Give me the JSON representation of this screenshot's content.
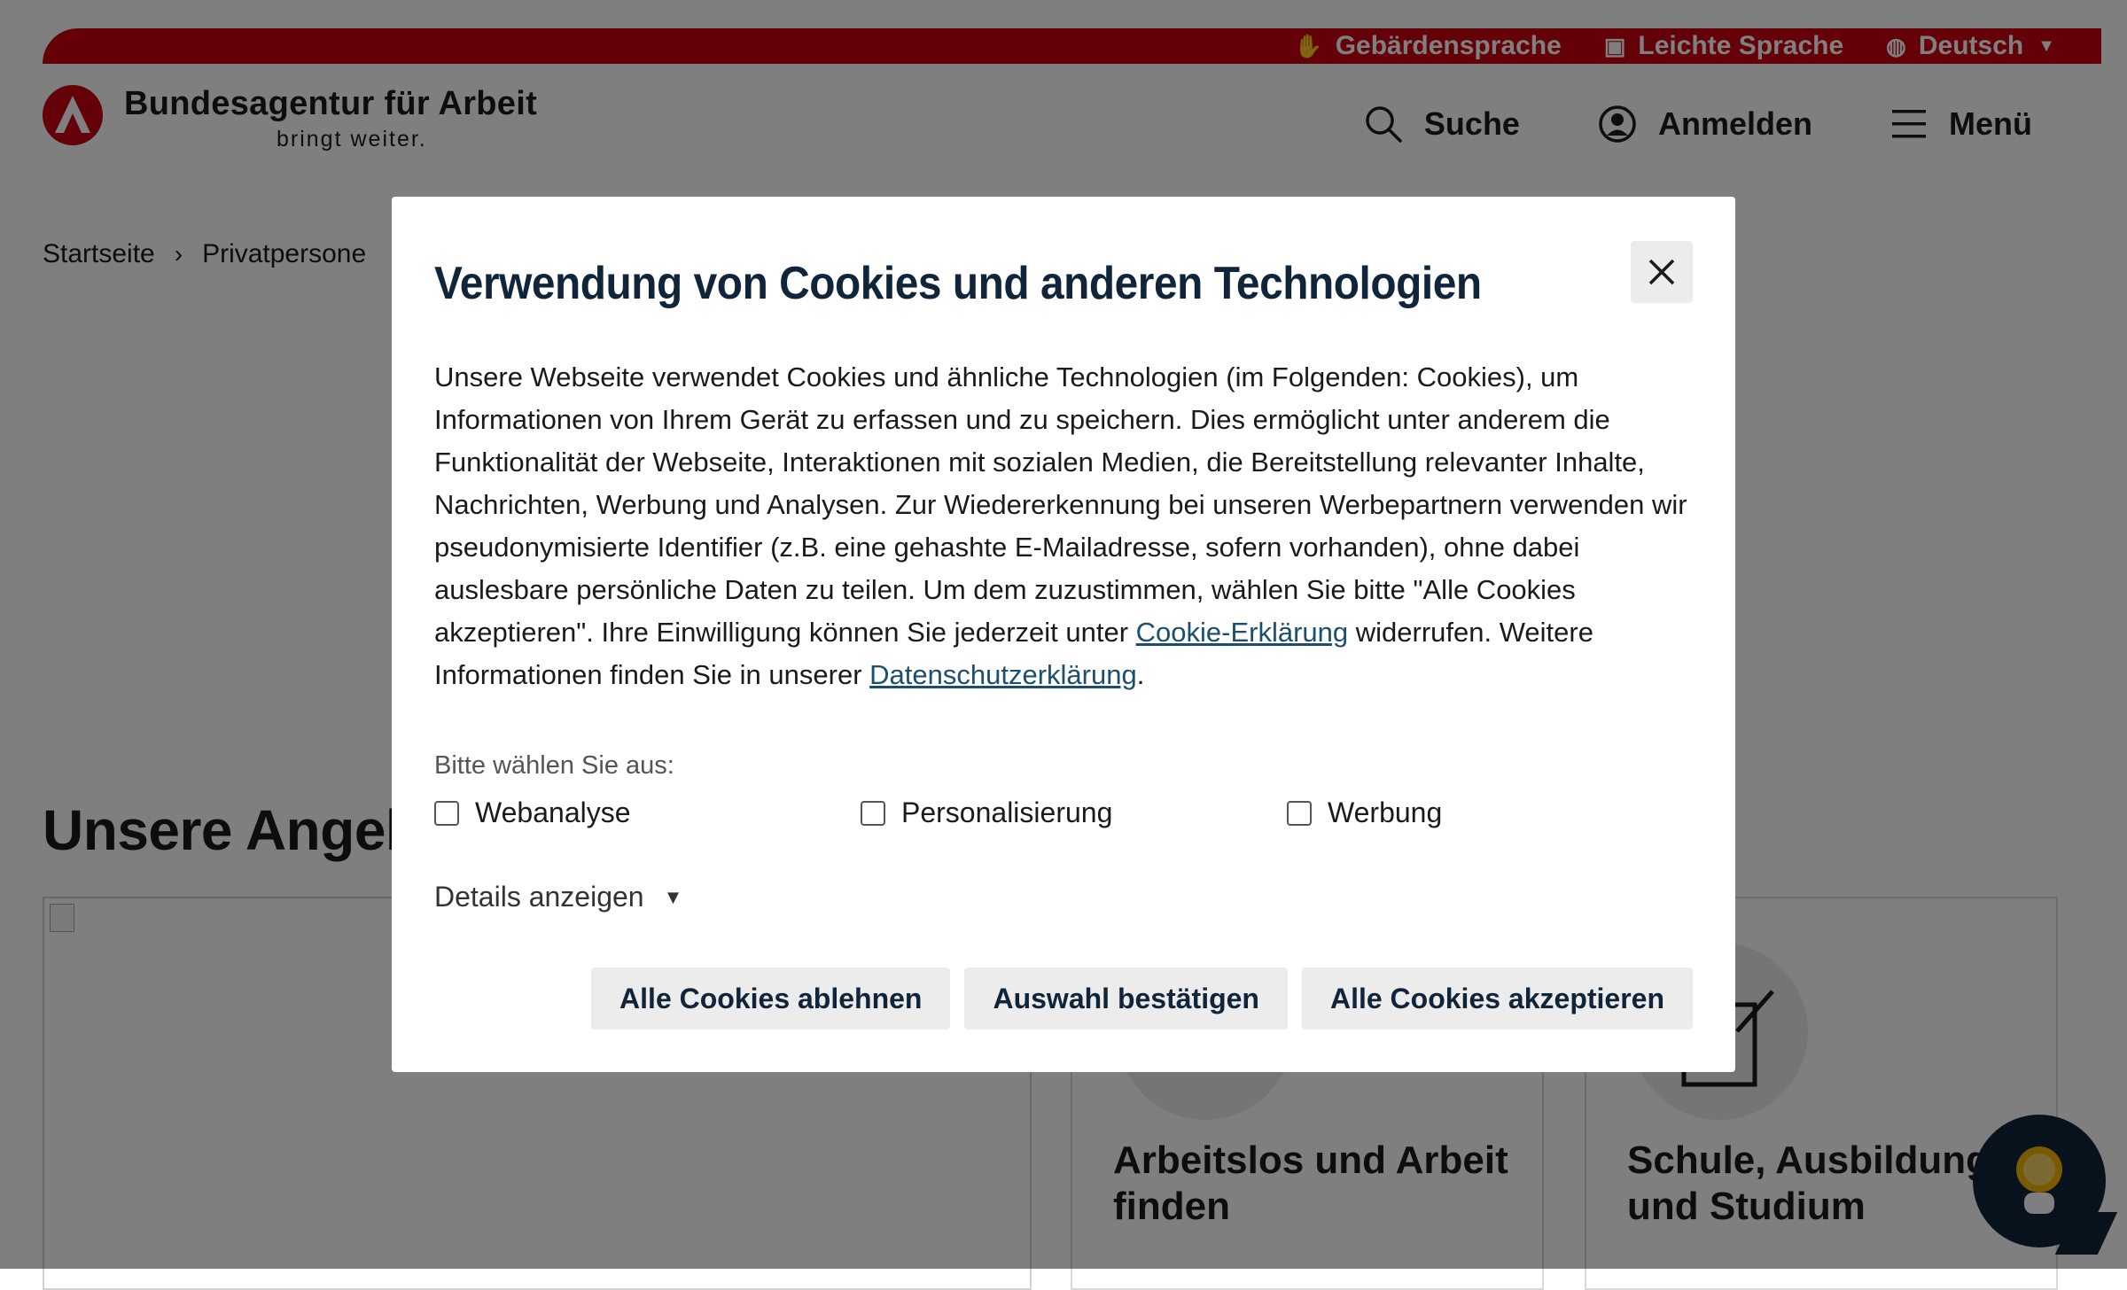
{
  "topbar": {
    "items": [
      {
        "label": "Gebärdensprache",
        "icon": "hand-sign-icon"
      },
      {
        "label": "Leichte Sprache",
        "icon": "easy-language-icon"
      },
      {
        "label": "Deutsch",
        "icon": "globe-icon"
      }
    ]
  },
  "header": {
    "logo_name": "Bundesagentur für Arbeit",
    "logo_slogan": "bringt weiter.",
    "nav": {
      "search": "Suche",
      "login": "Anmelden",
      "menu": "Menü"
    }
  },
  "breadcrumb": {
    "home": "Startseite",
    "current": "Privatpersone"
  },
  "main": {
    "section_title": "Unsere Angebot",
    "cards": [
      {
        "title": "Arbeitslos und Arbeit finden"
      },
      {
        "title": "Schule, Ausbildung und Studium"
      }
    ]
  },
  "modal": {
    "title": "Verwendung von Cookies und anderen Technologien",
    "text_before_link1": "Unsere Webseite verwendet Cookies und ähnliche Technologien (im Folgenden: Cookies), um Informationen von Ihrem Gerät zu erfassen und zu speichern. Dies ermöglicht unter anderem die Funktionalität der Webseite, Interaktionen mit sozialen Medien, die Bereitstellung relevanter Inhalte, Nachrichten, Werbung und Analysen. Zur Wiedererkennung bei unseren Werbepartnern verwenden wir pseudonymisierte Identifier (z.B. eine gehashte E-Mailadresse, sofern vorhanden), ohne dabei auslesbare persönliche Daten zu teilen. Um dem zuzustimmen, wählen Sie bitte \"Alle Cookies akzeptieren\". Ihre Einwilligung können Sie jederzeit unter ",
    "link1": "Cookie-Erklärung",
    "text_between": " widerrufen. Weitere Informationen finden Sie in unserer ",
    "link2": "Datenschutzerklärung",
    "text_after": ".",
    "choose_label": "Bitte wählen Sie aus:",
    "options": [
      {
        "label": "Webanalyse",
        "checked": false
      },
      {
        "label": "Personalisierung",
        "checked": false
      },
      {
        "label": "Werbung",
        "checked": false
      }
    ],
    "details_label": "Details anzeigen",
    "buttons": {
      "reject": "Alle Cookies ablehnen",
      "confirm": "Auswahl bestätigen",
      "accept": "Alle Cookies akzeptieren"
    }
  },
  "colors": {
    "brand_red": "#c8000f",
    "dark_blue": "#10253a",
    "link": "#1c4f6e"
  }
}
